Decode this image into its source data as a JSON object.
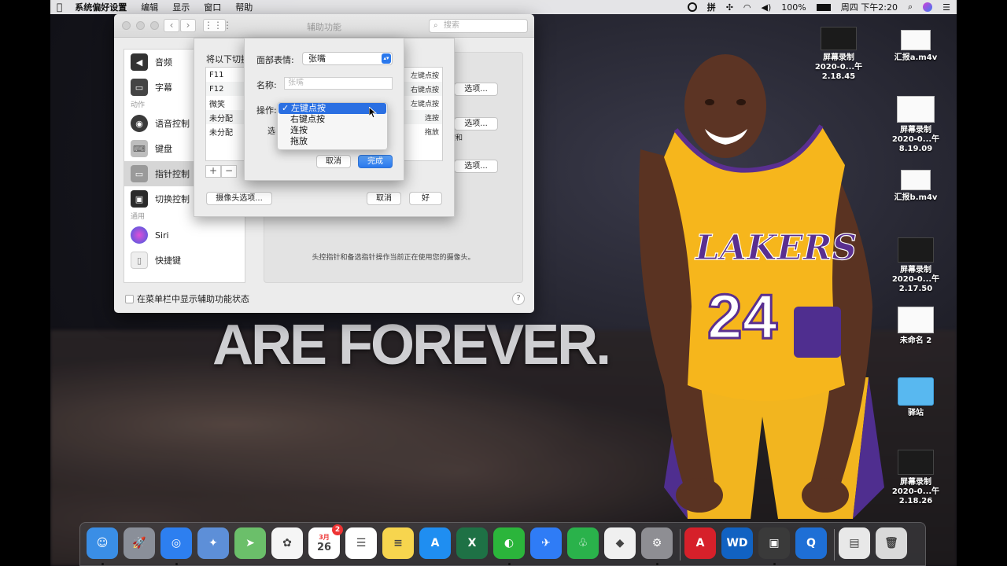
{
  "menubar": {
    "app_name": "系统偏好设置",
    "items": [
      "编辑",
      "显示",
      "窗口",
      "帮助"
    ],
    "status": {
      "input_method": "拼",
      "battery": "100%",
      "clock": "周四 下午2:20"
    }
  },
  "window": {
    "title": "辅助功能",
    "search_placeholder": "搜索",
    "sidebar": {
      "items": [
        {
          "label": "音频",
          "icon": "speaker-icon",
          "color": "#333333"
        },
        {
          "label": "字幕",
          "icon": "captions-icon",
          "color": "#444444"
        },
        {
          "section": "动作"
        },
        {
          "label": "语音控制",
          "icon": "voice-control-icon",
          "color": "#3a3a3a"
        },
        {
          "label": "键盘",
          "icon": "keyboard-icon",
          "color": "#bdbdbd"
        },
        {
          "label": "指针控制",
          "icon": "pointer-control-icon",
          "color": "#9a9a9a",
          "selected": true
        },
        {
          "label": "切换控制",
          "icon": "switch-control-icon",
          "color": "#2b2b2b"
        },
        {
          "section": "通用"
        },
        {
          "label": "Siri",
          "icon": "siri-icon",
          "color": "#6b4bd6"
        },
        {
          "label": "快捷键",
          "icon": "shortcut-icon",
          "color": "#dddddd"
        }
      ]
    },
    "main": {
      "option_buttons": [
        "选项...",
        "选项...",
        "选项..."
      ],
      "partial_text": "按和",
      "camera_note": "头控指针和备选指针操作当前正在使用您的摄像头。"
    },
    "footer": {
      "menu_checkbox_label": "在菜单栏中显示辅助功能状态",
      "help": "?"
    }
  },
  "sheet": {
    "label": "将以下切换",
    "rows": [
      {
        "key": "F11",
        "action": "左键点按"
      },
      {
        "key": "F12",
        "action": "右键点按"
      },
      {
        "key": "微笑",
        "action": "左键点按"
      },
      {
        "key": "未分配",
        "action": "连按"
      },
      {
        "key": "未分配",
        "action": "拖放"
      }
    ],
    "add": "+",
    "remove": "−",
    "camera_options": "摄像头选项...",
    "cancel": "取消",
    "ok": "好"
  },
  "sheet2": {
    "expression_label": "面部表情:",
    "expression_value": "张嘴",
    "name_label": "名称:",
    "name_placeholder": "张嘴",
    "action_label": "操作:",
    "option_label": "选",
    "cancel": "取消",
    "done": "完成",
    "action_menu": [
      {
        "label": "左键点按",
        "selected": true
      },
      {
        "label": "右键点按"
      },
      {
        "label": "连按"
      },
      {
        "label": "拖放"
      }
    ]
  },
  "wallpaper": {
    "slogan": "ARE FOREVER.",
    "jersey_team": "LAKERS",
    "jersey_number": "24"
  },
  "desktop_icons": [
    {
      "line1": "屏幕录制",
      "line2": "2020-0...午 2.18.45",
      "kind": "dark"
    },
    {
      "line1": "汇报a.m4v",
      "line2": "",
      "kind": "white"
    },
    {
      "line1": "屏幕录制",
      "line2": "2020-0...午 8.19.09",
      "kind": "white"
    },
    {
      "line1": "汇报b.m4v",
      "line2": "",
      "kind": "white"
    },
    {
      "line1": "屏幕录制",
      "line2": "2020-0...午 2.17.50",
      "kind": "dark"
    },
    {
      "line1": "未命名 2",
      "line2": "",
      "kind": "doc"
    },
    {
      "line1": "驿站",
      "line2": "",
      "kind": "folder"
    },
    {
      "line1": "屏幕录制",
      "line2": "2020-0...午 2.18.26",
      "kind": "dark"
    }
  ],
  "dock": {
    "apps": [
      {
        "name": "finder-icon",
        "color": "#3a8ee6",
        "glyph": "☺"
      },
      {
        "name": "launchpad-icon",
        "color": "#8a8f99",
        "glyph": "🚀"
      },
      {
        "name": "safari-icon",
        "color": "#2d7ff0",
        "glyph": "◎"
      },
      {
        "name": "preview-icon",
        "color": "#5d8fd8",
        "glyph": "✦"
      },
      {
        "name": "maps-icon",
        "color": "#6bbf6a",
        "glyph": "➤"
      },
      {
        "name": "photos-icon",
        "color": "#f5f5f5",
        "glyph": "✿"
      },
      {
        "name": "calendar-icon",
        "color": "#ffffff",
        "glyph": "26",
        "month": "3月",
        "badge": "2"
      },
      {
        "name": "reminders-icon",
        "color": "#ffffff",
        "glyph": "☰"
      },
      {
        "name": "notes-icon",
        "color": "#f7d54e",
        "glyph": "≡"
      },
      {
        "name": "app-store-icon",
        "color": "#1f8ef1",
        "glyph": "A"
      },
      {
        "name": "excel-icon",
        "color": "#1e7145",
        "glyph": "X"
      },
      {
        "name": "wechat-icon",
        "color": "#2bb53b",
        "glyph": "◐"
      },
      {
        "name": "feishu-icon",
        "color": "#2f7cf6",
        "glyph": "✈"
      },
      {
        "name": "evernote-icon",
        "color": "#2ab24b",
        "glyph": "♧"
      },
      {
        "name": "sketch-icon",
        "color": "#f0f0f0",
        "glyph": "◆"
      },
      {
        "name": "system-preferences-icon",
        "color": "#8e8e93",
        "glyph": "⚙"
      },
      {
        "name": "acrobat-icon",
        "color": "#d6202a",
        "glyph": "A"
      },
      {
        "name": "wd-icon",
        "color": "#1162c2",
        "glyph": "WD"
      },
      {
        "name": "screenshot-icon",
        "color": "#3a3a3a",
        "glyph": "▣"
      },
      {
        "name": "quicktime-icon",
        "color": "#1e6fd6",
        "glyph": "Q"
      },
      {
        "name": "downloads-stack-icon",
        "color": "#e8e8e8",
        "glyph": "▤"
      },
      {
        "name": "trash-icon",
        "color": "#d9d9d9",
        "glyph": "🗑"
      }
    ]
  }
}
